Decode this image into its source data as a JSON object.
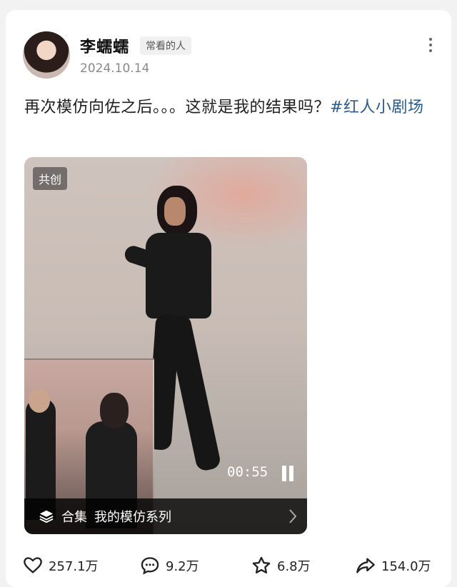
{
  "author": {
    "name": "李蠕蠕",
    "badge": "常看的人",
    "date": "2024.10.14"
  },
  "post": {
    "text": "再次模仿向佐之后。。。这就是我的结果吗？",
    "hashtag": "#红人小剧场"
  },
  "media": {
    "tag": "共创",
    "duration": "00:55",
    "collection_label": "合集",
    "collection_name": "我的模仿系列"
  },
  "actions": {
    "likes": "257.1万",
    "comments": "9.2万",
    "favorites": "6.8万",
    "shares": "154.0万"
  },
  "icons": [
    "more-icon",
    "layers-icon",
    "chevron-right-icon",
    "pause-icon",
    "heart-icon",
    "comment-icon",
    "star-icon",
    "share-icon"
  ],
  "colors": {
    "hashtag": "#2b5a8c",
    "text": "#222222",
    "meta": "#8a8a8a"
  }
}
